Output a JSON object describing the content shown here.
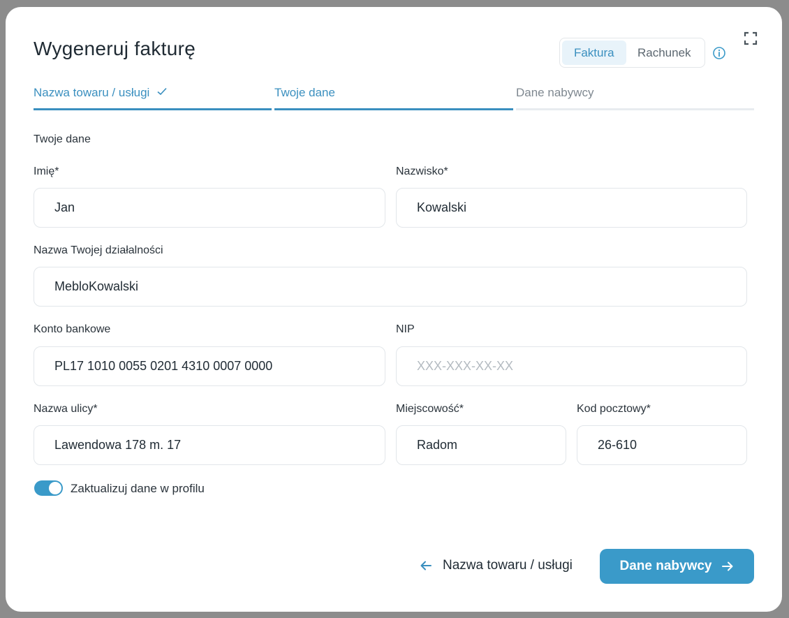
{
  "modal": {
    "title": "Wygeneruj fakturę",
    "doc_type": {
      "options": [
        "Faktura",
        "Rachunek"
      ],
      "selected": "Faktura"
    },
    "icons": {
      "info": "info-icon",
      "expand": "expand-icon"
    }
  },
  "steps": [
    {
      "label": "Nazwa towaru / usługi",
      "state": "done"
    },
    {
      "label": "Twoje dane",
      "state": "current"
    },
    {
      "label": "Dane nabywcy",
      "state": "todo"
    }
  ],
  "form": {
    "section_title": "Twoje dane",
    "first_name": {
      "label": "Imię*",
      "value": "Jan"
    },
    "last_name": {
      "label": "Nazwisko*",
      "value": "Kowalski"
    },
    "business_name": {
      "label": "Nazwa Twojej działalności",
      "value": "MebloKowalski"
    },
    "bank_account": {
      "label": "Konto bankowe",
      "value": "PL17 1010 0055 0201 4310 0007 0000"
    },
    "nip": {
      "label": "NIP",
      "value": "",
      "placeholder": "XXX-XXX-XX-XX"
    },
    "street": {
      "label": "Nazwa ulicy*",
      "value": "Lawendowa 178 m. 17"
    },
    "city": {
      "label": "Miejscowość*",
      "value": "Radom"
    },
    "postal_code": {
      "label": "Kod pocztowy*",
      "value": "26-610"
    },
    "update_profile": {
      "label": "Zaktualizuj dane w profilu",
      "enabled": true
    }
  },
  "footer": {
    "back_label": "Nazwa towaru / usługi",
    "next_label": "Dane nabywcy"
  },
  "colors": {
    "accent": "#3a9ac9",
    "accent_text": "#3a8fbf",
    "backdrop": "#8c8c8c"
  }
}
